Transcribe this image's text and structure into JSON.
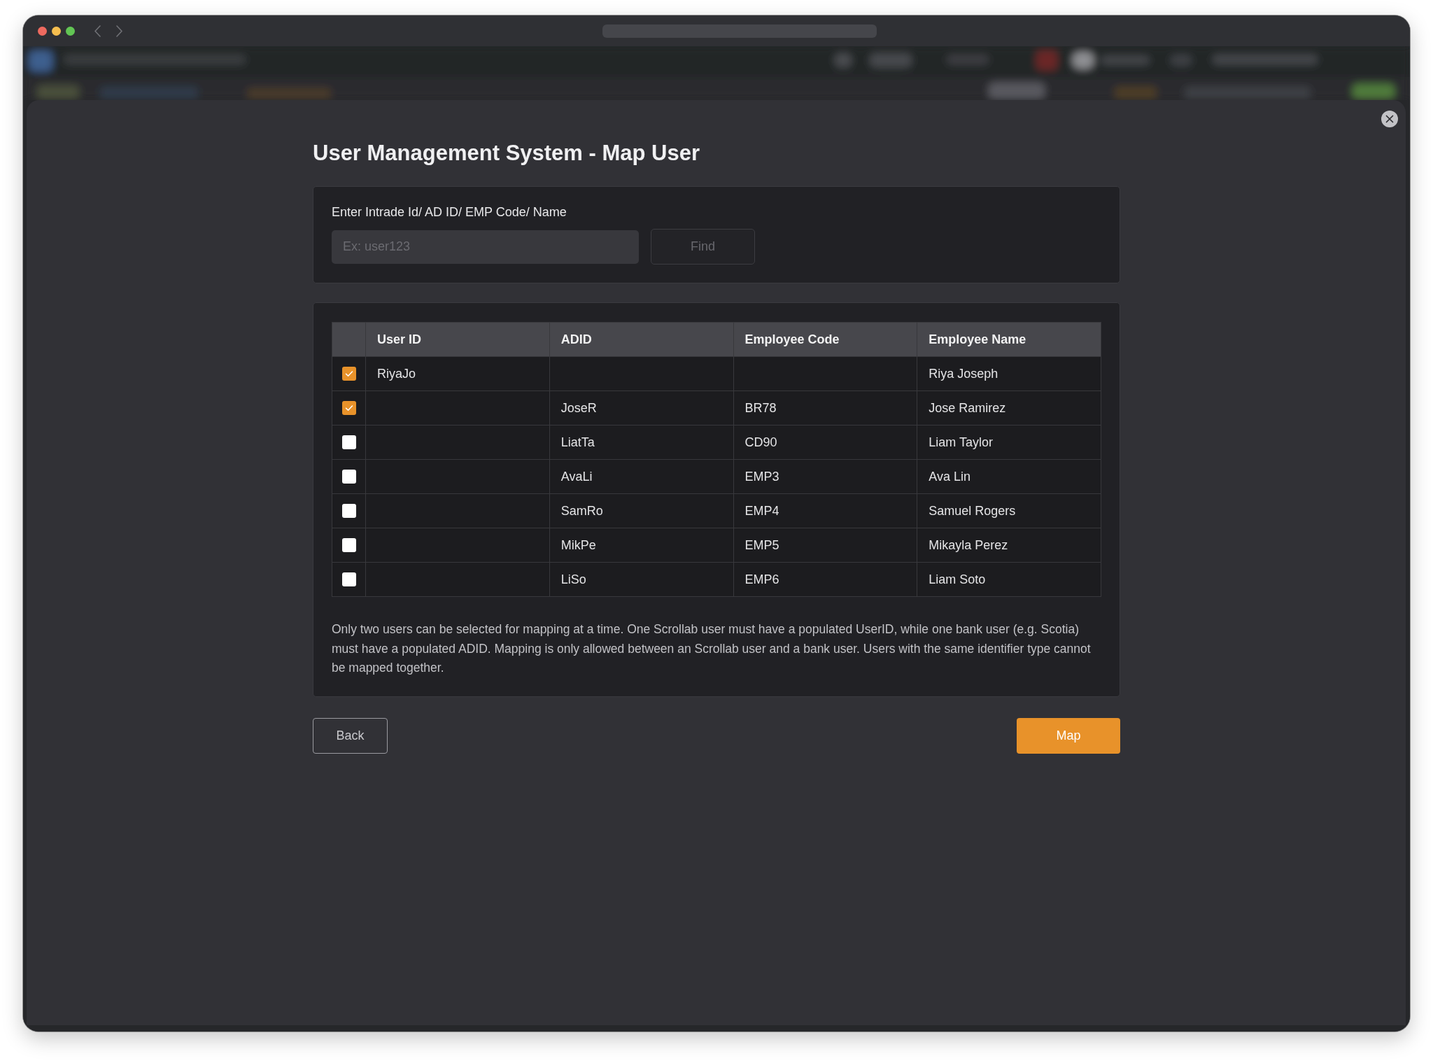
{
  "dialog": {
    "title": "User Management System - Map User",
    "search": {
      "label": "Enter Intrade Id/ AD ID/ EMP Code/ Name",
      "placeholder": "Ex: user123",
      "find_button": {
        "label": "Find",
        "disabled": true
      }
    },
    "table": {
      "columns": [
        "User ID",
        "ADID",
        "Employee Code",
        "Employee Name"
      ],
      "rows": [
        {
          "checked": true,
          "user_id": "RiyaJo",
          "employee_name": "Riya Joseph"
        },
        {
          "checked": true,
          "adid": "JoseR",
          "employee_code": "BR78",
          "employee_name": "Jose Ramirez"
        },
        {
          "checked": false,
          "adid": "LiatTa",
          "employee_code": "CD90",
          "employee_name": "Liam Taylor"
        },
        {
          "checked": false,
          "adid": "AvaLi",
          "employee_code": "EMP3",
          "employee_name": "Ava Lin"
        },
        {
          "checked": false,
          "adid": "SamRo",
          "employee_code": "EMP4",
          "employee_name": "Samuel Rogers"
        },
        {
          "checked": false,
          "adid": "MikPe",
          "employee_code": "EMP5",
          "employee_name": "Mikayla Perez"
        },
        {
          "checked": false,
          "adid": "LiSo",
          "employee_code": "EMP6",
          "employee_name": "Liam Soto"
        }
      ]
    },
    "note": "Only two users can be selected for mapping at a time. One Scrollab user must have a populated UserID, while one bank user (e.g. Scotia) must have a populated ADID. Mapping is only allowed between an Scrollab user and a bank user. Users with the same identifier type cannot be mapped together.",
    "buttons": [
      {
        "label": "Back",
        "kind": "secondary"
      },
      {
        "label": "Map",
        "kind": "primary"
      }
    ]
  }
}
